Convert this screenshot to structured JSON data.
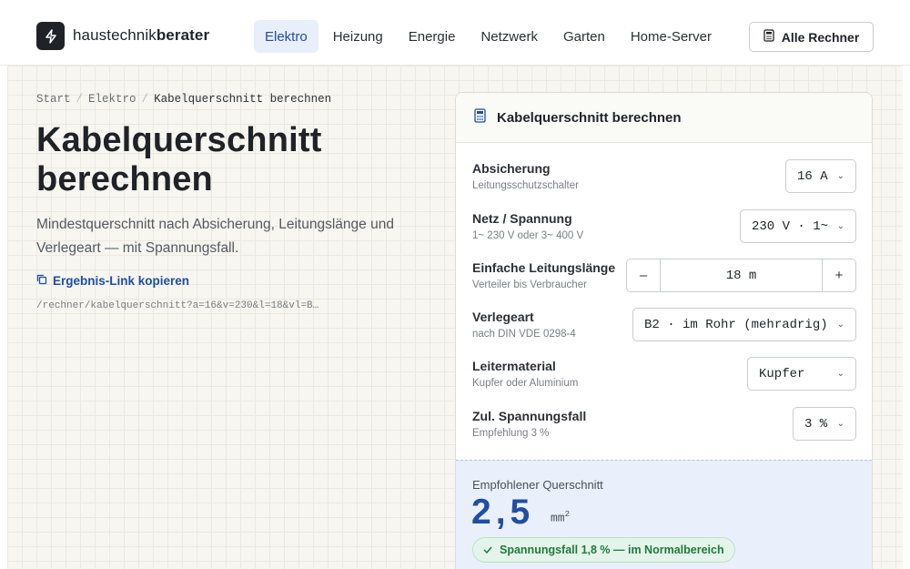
{
  "header": {
    "brand_prefix": "haustechnik",
    "brand_suffix": "berater",
    "nav": [
      "Elektro",
      "Heizung",
      "Energie",
      "Netzwerk",
      "Garten",
      "Home-Server"
    ],
    "active_nav": "Elektro",
    "all_calculators": "Alle Rechner"
  },
  "breadcrumb": {
    "items": [
      "Start",
      "Elektro",
      "Kabelquerschnitt berechnen"
    ],
    "separator": "/"
  },
  "hero": {
    "title": "Kabelquerschnitt berechnen",
    "subtitle": "Mindestquerschnitt nach Absicherung, Leitungslänge und Verlegeart — mit Spannungsfall.",
    "copy_link": "Ergebnis-Link kopieren",
    "url": "/rechner/kabelquerschnitt?a=16&v=230&l=18&vl=B…"
  },
  "calculator": {
    "title": "Kabelquerschnitt berechnen",
    "fields": {
      "fuse": {
        "label": "Absicherung",
        "hint": "Leitungsschutzschalter",
        "value": "16 A"
      },
      "voltage": {
        "label": "Netz / Spannung",
        "hint": "1~ 230 V oder 3~ 400 V",
        "value": "230 V · 1~"
      },
      "length": {
        "label": "Einfache Leitungslänge",
        "hint": "Verteiler bis Verbraucher",
        "value": "18 m",
        "minus": "–",
        "plus": "+"
      },
      "installation": {
        "label": "Verlegeart",
        "hint": "nach DIN VDE 0298-4",
        "value": "B2 · im Rohr (mehradrig)"
      },
      "material": {
        "label": "Leitermaterial",
        "hint": "Kupfer oder Aluminium",
        "value": "Kupfer"
      },
      "voltage_drop": {
        "label": "Zul. Spannungsfall",
        "hint": "Empfehlung 3 %",
        "value": "3 %"
      }
    },
    "result": {
      "label": "Empfohlener Querschnitt",
      "value": "2,5",
      "unit": "mm",
      "unit_sup": "2",
      "status": "Spannungsfall 1,8 % — im Normalbereich"
    }
  },
  "colors": {
    "accent": "#1f4fa3",
    "dark": "#1f2328",
    "success": "#1f7a3d",
    "result_bg": "#e9f0fb"
  }
}
